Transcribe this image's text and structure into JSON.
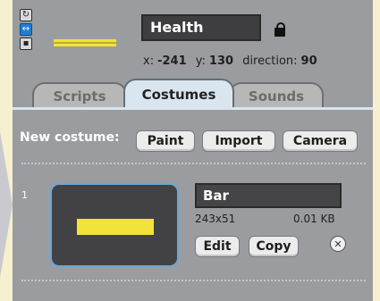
{
  "sprite": {
    "name": "Health",
    "x_label": "x:",
    "x_value": "-241",
    "y_label": "y:",
    "y_value": "130",
    "direction_label": "direction:",
    "direction_value": "90",
    "thumbnail_color": "#f2e33a"
  },
  "rotation_buttons": [
    {
      "icon": "rotate-icon",
      "glyph": "↻",
      "active": false
    },
    {
      "icon": "left-right-icon",
      "glyph": "↔",
      "active": true
    },
    {
      "icon": "no-rotate-icon",
      "glyph": "▪",
      "active": false
    }
  ],
  "tabs": [
    {
      "label": "Scripts",
      "active": false
    },
    {
      "label": "Costumes",
      "active": true
    },
    {
      "label": "Sounds",
      "active": false
    }
  ],
  "costumes_panel": {
    "new_costume_label": "New costume:",
    "paint_label": "Paint",
    "import_label": "Import",
    "camera_label": "Camera"
  },
  "costumes": [
    {
      "index": "1",
      "name": "Bar",
      "dimensions": "243x51",
      "size": "0.01 KB",
      "edit_label": "Edit",
      "copy_label": "Copy",
      "delete_glyph": "✕"
    }
  ],
  "colors": {
    "panel_bg": "#9a9c9f",
    "accent_blue": "#1f7fd8",
    "costume_color": "#f2e33a"
  }
}
